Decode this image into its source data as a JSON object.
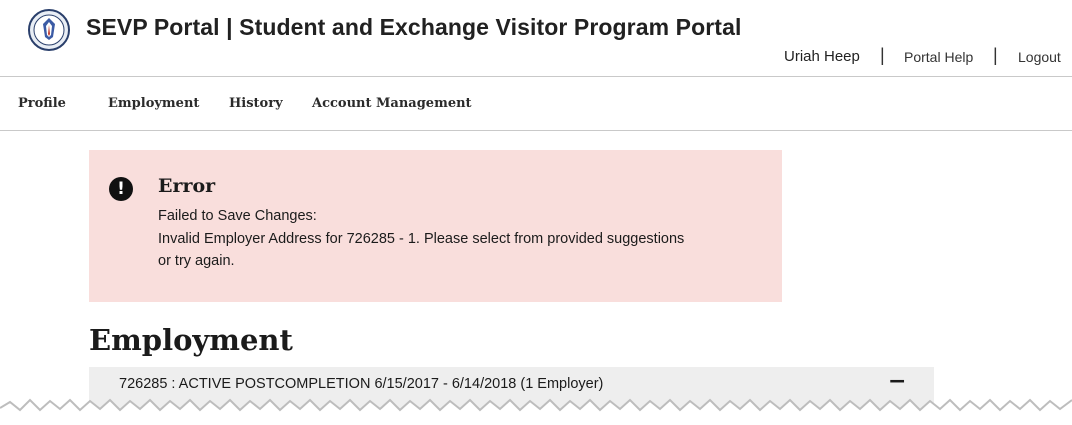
{
  "header": {
    "seal_icon": "dhs-seal-icon",
    "title": "SEVP Portal | Student and Exchange Visitor Program Portal",
    "user_name": "Uriah Heep",
    "separator": "|",
    "portal_help": "Portal Help",
    "logout": "Logout"
  },
  "nav": {
    "items": [
      {
        "label": "Profile"
      },
      {
        "label": "Employment"
      },
      {
        "label": "History"
      },
      {
        "label": "Account Management"
      }
    ]
  },
  "alert": {
    "icon": "exclamation-circle-icon",
    "heading": "Error",
    "lines": [
      "Failed to Save Changes:",
      "Invalid Employer Address for 726285 - 1. Please select from provided suggestions",
      "or try again."
    ],
    "background": "#f9dedc"
  },
  "main": {
    "title": "Employment",
    "accordion": {
      "label": "726285 : ACTIVE POSTCOMPLETION 6/15/2017 - 6/14/2018 (1 Employer)",
      "toggle": "−",
      "toggle_icon": "collapse-minus-icon"
    }
  }
}
